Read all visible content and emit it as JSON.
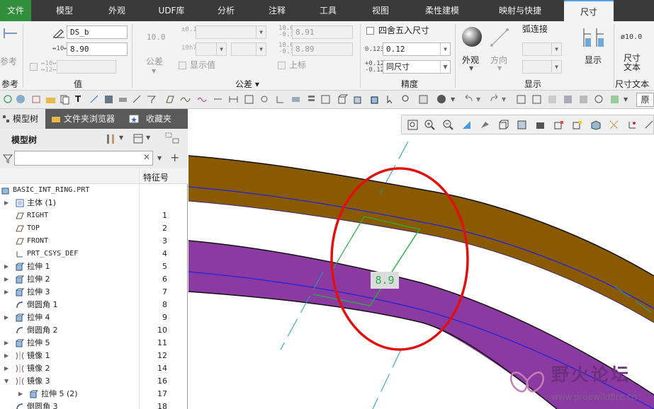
{
  "menu": {
    "tabs": [
      "文件",
      "模型",
      "外观",
      "UDF库",
      "分析",
      "注释",
      "工具",
      "视图",
      "柔性建模",
      "映射与快捷",
      "尺寸"
    ],
    "active": "尺寸"
  },
  "ribbon": {
    "reference": {
      "label": "参考",
      "group": "参考"
    },
    "value": {
      "name_value": "DS_b",
      "dim_value": "8.90",
      "group": "值"
    },
    "tolerance": {
      "nominal": "10.0",
      "tol_label": "公差",
      "show_values": "显示值",
      "upper_value": "8.91",
      "lower_value": "8.89",
      "superscript": "上标",
      "group": "公差"
    },
    "precision": {
      "round_label": "四舍五入尺寸",
      "decimal_value": "0.12",
      "tol_precision": "同尺寸",
      "group": "精度"
    },
    "display": {
      "appearance": "外观",
      "direction": "方向",
      "arc_connect": "弧连接",
      "show": "显示",
      "group": "显示"
    },
    "dim_text": {
      "icon_label": "ø10.0",
      "label": "尺寸\n文本",
      "group": "尺寸文本"
    },
    "prefix_label": "原"
  },
  "panel": {
    "tabs": [
      "模型树",
      "文件夹浏览器",
      "收藏夹"
    ],
    "title": "模型树",
    "filter_placeholder": "",
    "column": "特征号",
    "items": [
      {
        "name": "BASIC_INT_RING.PRT",
        "num": "",
        "level": 0,
        "expand": "",
        "icon": "part",
        "mono": true
      },
      {
        "name": "主体 (1)",
        "num": "",
        "level": 1,
        "expand": "▶",
        "icon": "body",
        "mono": false
      },
      {
        "name": "RIGHT",
        "num": "1",
        "level": 1,
        "expand": "",
        "icon": "plane",
        "mono": true
      },
      {
        "name": "TOP",
        "num": "2",
        "level": 1,
        "expand": "",
        "icon": "plane",
        "mono": true
      },
      {
        "name": "FRONT",
        "num": "3",
        "level": 1,
        "expand": "",
        "icon": "plane",
        "mono": true
      },
      {
        "name": "PRT_CSYS_DEF",
        "num": "4",
        "level": 1,
        "expand": "",
        "icon": "csys",
        "mono": true
      },
      {
        "name": "拉伸 1",
        "num": "5",
        "level": 1,
        "expand": "▶",
        "icon": "extrude",
        "mono": false
      },
      {
        "name": "拉伸 2",
        "num": "6",
        "level": 1,
        "expand": "▶",
        "icon": "extrude",
        "mono": false
      },
      {
        "name": "拉伸 3",
        "num": "7",
        "level": 1,
        "expand": "▶",
        "icon": "extrude",
        "mono": false
      },
      {
        "name": "倒圆角 1",
        "num": "8",
        "level": 1,
        "expand": "",
        "icon": "round",
        "mono": false
      },
      {
        "name": "拉伸 4",
        "num": "9",
        "level": 1,
        "expand": "▶",
        "icon": "extrude",
        "mono": false
      },
      {
        "name": "倒圆角 2",
        "num": "10",
        "level": 1,
        "expand": "",
        "icon": "round",
        "mono": false
      },
      {
        "name": "拉伸 5",
        "num": "11",
        "level": 1,
        "expand": "▶",
        "icon": "extrude",
        "mono": false
      },
      {
        "name": "镜像 1",
        "num": "12",
        "level": 1,
        "expand": "▶",
        "icon": "mirror",
        "mono": false
      },
      {
        "name": "镜像 2",
        "num": "14",
        "level": 1,
        "expand": "▶",
        "icon": "mirror",
        "mono": false
      },
      {
        "name": "镜像 3",
        "num": "16",
        "level": 1,
        "expand": "▼",
        "icon": "mirror",
        "mono": false
      },
      {
        "name": "拉伸 5 (2)",
        "num": "17",
        "level": 2,
        "expand": "▶",
        "icon": "extrude",
        "mono": false
      },
      {
        "name": "倒圆角 3",
        "num": "18",
        "level": 1,
        "expand": "",
        "icon": "round",
        "mono": false
      }
    ]
  },
  "viewport": {
    "dimension_value": "8.9",
    "watermark_cn": "野火论坛",
    "watermark_url": "www.proewildfire.cn"
  },
  "colors": {
    "upper_band": "#8a5a00",
    "lower_band": "#8a3aa0",
    "accent_green": "#22b042",
    "circle_red": "#e01010"
  }
}
